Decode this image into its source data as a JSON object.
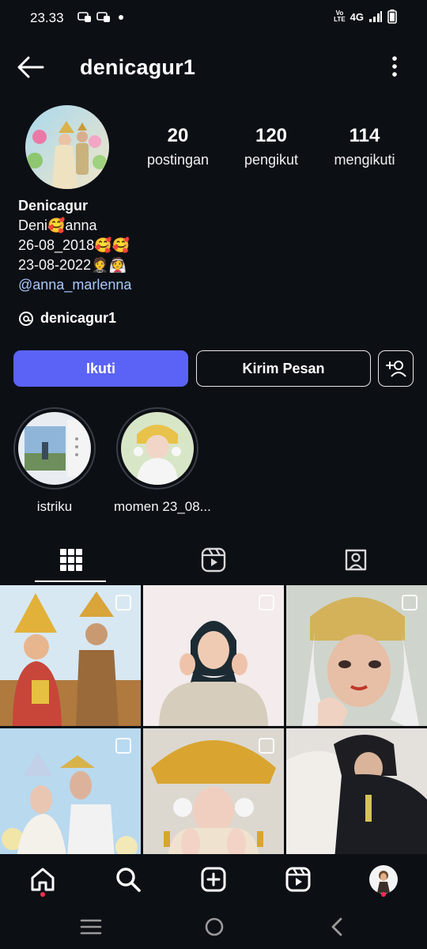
{
  "status_bar": {
    "time": "23.33",
    "network": "4G",
    "volte": "VoB\nLTE"
  },
  "header": {
    "username": "denicagur1"
  },
  "stats": [
    {
      "value": "20",
      "label": "postingan"
    },
    {
      "value": "120",
      "label": "pengikut"
    },
    {
      "value": "114",
      "label": "mengikuti"
    }
  ],
  "bio": {
    "name": "Denicagur",
    "line1": "Deni🥰anna",
    "line2": "26-08_2018🥰🥰",
    "line3": "23-08-2022🤵👰",
    "mention": "@anna_marlenna"
  },
  "threads": {
    "handle": "denicagur1"
  },
  "buttons": {
    "follow": "Ikuti",
    "message": "Kirim Pesan"
  },
  "highlights": [
    {
      "label": "istriku"
    },
    {
      "label": "momen 23_08..."
    }
  ],
  "tabs": [
    {
      "icon": "grid-icon",
      "active": true
    },
    {
      "icon": "reels-icon",
      "active": false
    },
    {
      "icon": "tagged-icon",
      "active": false
    }
  ],
  "bottom_nav": [
    "home-icon",
    "search-icon",
    "create-icon",
    "reels-icon",
    "profile-avatar"
  ],
  "colors": {
    "follow": "#5a63f5",
    "link": "#a8c8ff",
    "background": "#0c0f14",
    "notification_dot": "#ff2d55"
  }
}
